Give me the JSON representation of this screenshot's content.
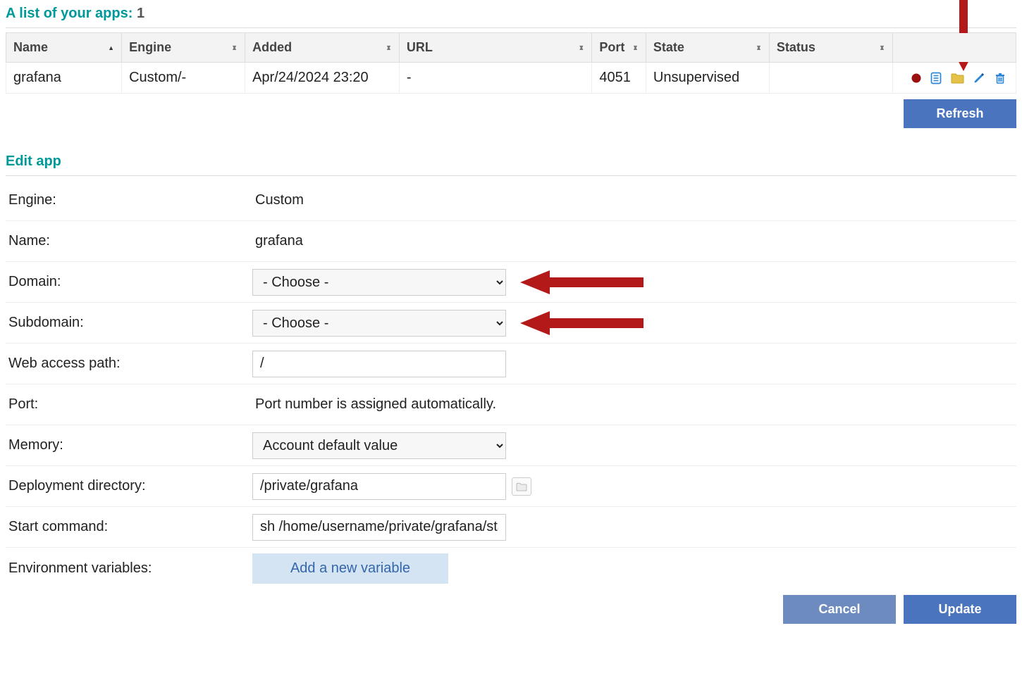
{
  "list": {
    "title": "A list of your apps:",
    "count": "1",
    "headers": {
      "name": "Name",
      "engine": "Engine",
      "added": "Added",
      "url": "URL",
      "port": "Port",
      "state": "State",
      "status": "Status"
    },
    "rows": [
      {
        "name": "grafana",
        "engine": "Custom/-",
        "added": "Apr/24/2024 23:20",
        "url": "-",
        "port": "4051",
        "state": "Unsupervised",
        "status": ""
      }
    ],
    "refresh_label": "Refresh"
  },
  "edit": {
    "title": "Edit app",
    "fields": {
      "engine_label": "Engine:",
      "engine_value": "Custom",
      "name_label": "Name:",
      "name_value": "grafana",
      "domain_label": "Domain:",
      "domain_value": "- Choose -",
      "subdomain_label": "Subdomain:",
      "subdomain_value": "- Choose -",
      "webpath_label": "Web access path:",
      "webpath_value": "/",
      "port_label": "Port:",
      "port_value": "Port number is assigned automatically.",
      "memory_label": "Memory:",
      "memory_value": "Account default value",
      "deploydir_label": "Deployment directory:",
      "deploydir_value": "/private/grafana",
      "startcmd_label": "Start command:",
      "startcmd_value": "sh /home/username/private/grafana/start",
      "env_label": "Environment variables:",
      "env_add_label": "Add a new variable"
    },
    "cancel_label": "Cancel",
    "update_label": "Update"
  },
  "colors": {
    "accent": "#009999",
    "button": "#4a74bd",
    "arrow": "#b31919"
  }
}
